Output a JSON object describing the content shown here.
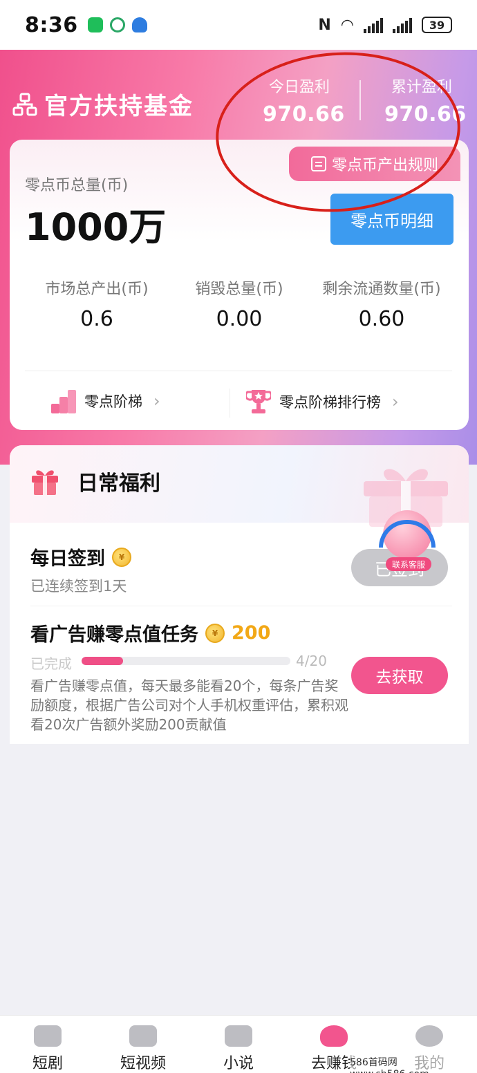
{
  "status_bar": {
    "time": "8:36",
    "battery": "39"
  },
  "header": {
    "title": "官方扶持基金",
    "today_profit_label": "今日盈利",
    "today_profit_value": "970.66",
    "total_profit_label": "累计盈利",
    "total_profit_value": "970.66"
  },
  "coin_card": {
    "rules_tab": "零点币产出规则",
    "total_label": "零点币总量(币)",
    "total_value": "1000万",
    "detail_button": "零点币明细",
    "stats": [
      {
        "label": "市场总产出(币)",
        "value": "0.6"
      },
      {
        "label": "销毁总量(币)",
        "value": "0.00"
      },
      {
        "label": "剩余流通数量(币)",
        "value": "0.60"
      }
    ],
    "links": [
      {
        "label": "零点阶梯"
      },
      {
        "label": "零点阶梯排行榜"
      }
    ]
  },
  "benefits": {
    "title": "日常福利",
    "checkin": {
      "title": "每日签到",
      "subtitle": "已连续签到1天",
      "button": "已签到"
    },
    "ad_task": {
      "title": "看广告赚零点值任务",
      "reward": "200",
      "progress_label": "已完成",
      "progress_count": "4/20",
      "progress_fraction": 0.2,
      "description": "看广告赚零点值，每天最多能看20个，每条广告奖励额度，根据广告公司对个人手机权重评估，累积观看20次广告额外奖励200贡献值",
      "button": "去获取"
    }
  },
  "customer_service": {
    "label": "联系客服"
  },
  "bottom_nav": [
    {
      "label": "短剧",
      "icon": "tv-clip-icon"
    },
    {
      "label": "短视频",
      "icon": "video-icon"
    },
    {
      "label": "小说",
      "icon": "book-icon"
    },
    {
      "label": "去赚钱",
      "icon": "money-bag-icon"
    },
    {
      "label": "我的",
      "icon": "profile-icon"
    }
  ],
  "watermark": "586首码网 www.sh586.com",
  "colors": {
    "brand_pink": "#f2558e",
    "detail_blue": "#3c9bf0",
    "coin_gold": "#f2a816",
    "annotation_red": "#d8201a"
  }
}
